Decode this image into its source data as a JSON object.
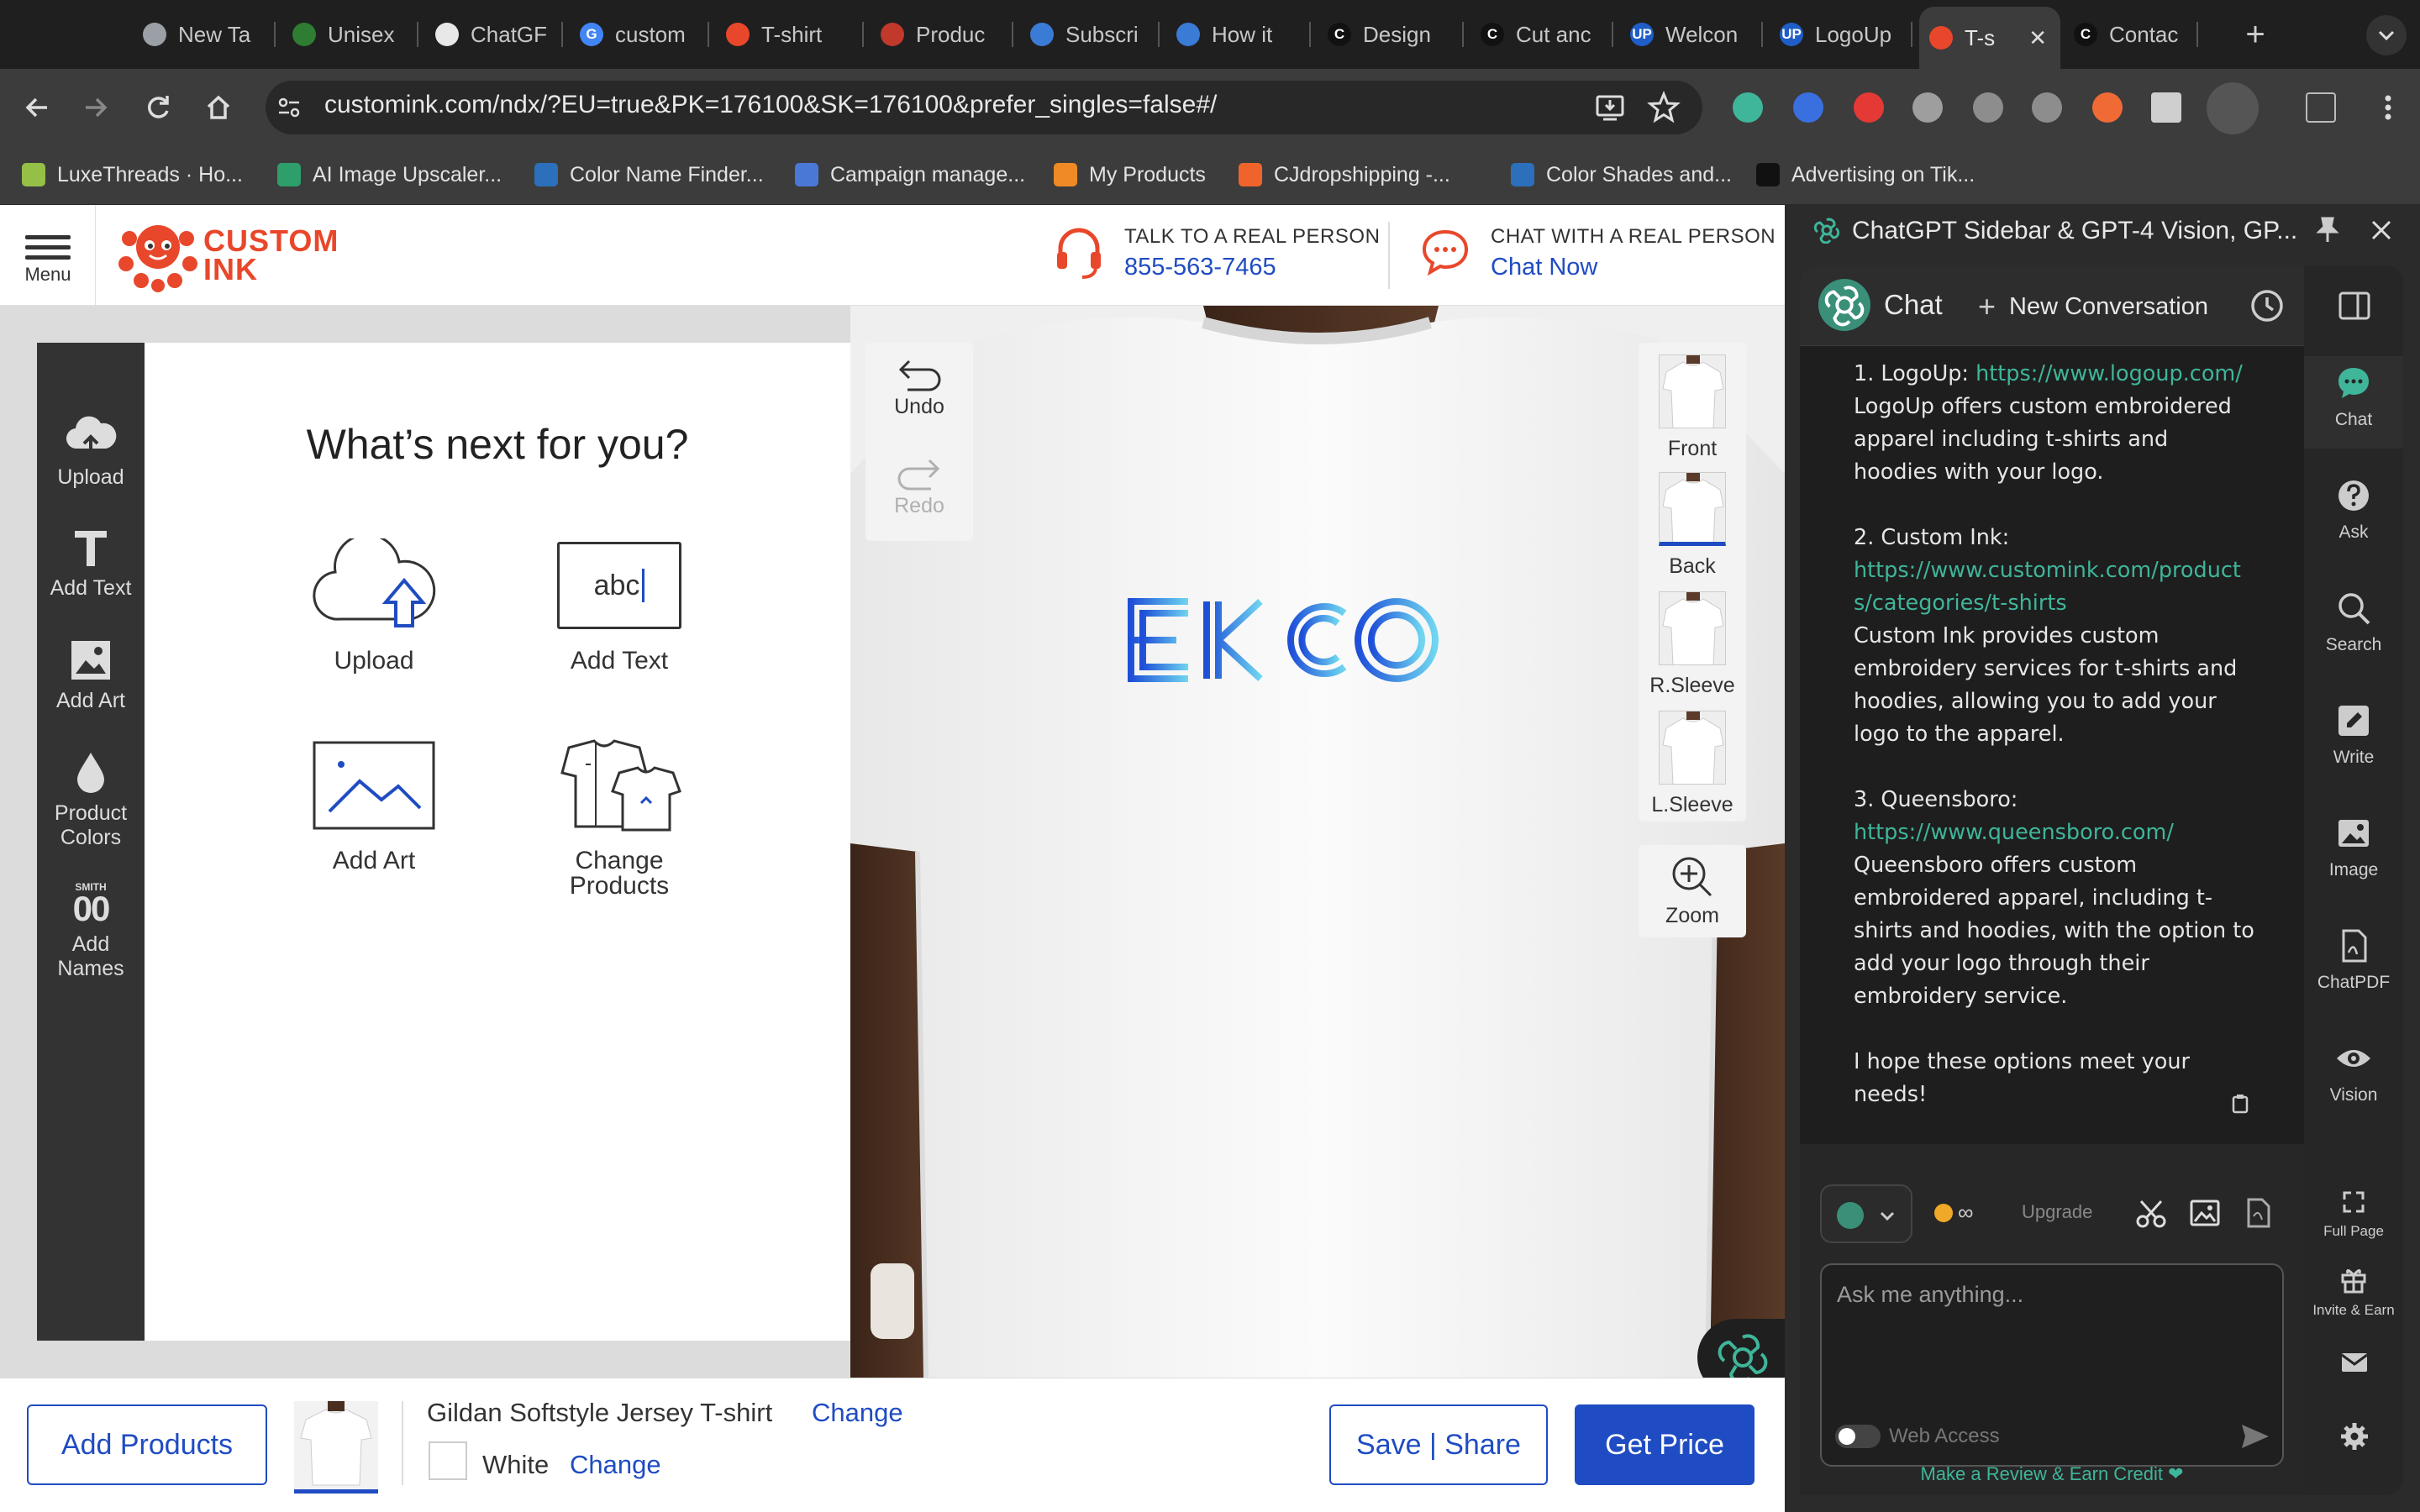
{
  "browser": {
    "tabs": [
      {
        "label": "New Ta",
        "favicon_color": "#9aa0a6",
        "favicon_letter": ""
      },
      {
        "label": "Unisex",
        "favicon_color": "#2e7d32",
        "favicon_letter": ""
      },
      {
        "label": "ChatGF",
        "favicon_color": "#e8e8e8",
        "favicon_letter": ""
      },
      {
        "label": "custom",
        "favicon_color": "#4285f4",
        "favicon_letter": "G"
      },
      {
        "label": "T-shirt",
        "favicon_color": "#e8472b",
        "favicon_letter": ""
      },
      {
        "label": "Produc",
        "favicon_color": "#c0392b",
        "favicon_letter": ""
      },
      {
        "label": "Subscri",
        "favicon_color": "#3a7bd5",
        "favicon_letter": ""
      },
      {
        "label": "How it",
        "favicon_color": "#3a7bd5",
        "favicon_letter": ""
      },
      {
        "label": "Design",
        "favicon_color": "#111111",
        "favicon_letter": "C"
      },
      {
        "label": "Cut anc",
        "favicon_color": "#111111",
        "favicon_letter": "C"
      },
      {
        "label": "Welcon",
        "favicon_color": "#1f5ec7",
        "favicon_letter": "UP"
      },
      {
        "label": "LogoUp",
        "favicon_color": "#1f5ec7",
        "favicon_letter": "UP"
      },
      {
        "label": "T-s",
        "favicon_color": "#e8472b",
        "favicon_letter": "",
        "active": true
      },
      {
        "label": "Contac",
        "favicon_color": "#111111",
        "favicon_letter": "C"
      }
    ],
    "new_tab_symbol": "+",
    "close_tab_symbol": "✕",
    "url": "customink.com/ndx/?EU=true&PK=176100&SK=176100&prefer_singles=false#/",
    "bookmarks": [
      {
        "label": "LuxeThreads · Ho...",
        "color": "#95bf47"
      },
      {
        "label": "AI Image Upscaler...",
        "color": "#2e9e6b"
      },
      {
        "label": "Color Name Finder...",
        "color": "#2c6fbb"
      },
      {
        "label": "Campaign manage...",
        "color": "#4a78d6"
      },
      {
        "label": "My Products",
        "color": "#f08a24"
      },
      {
        "label": "CJdropshipping -...",
        "color": "#f0642b"
      },
      {
        "label": "Color Shades and...",
        "color": "#2c6fbb"
      },
      {
        "label": "Advertising on Tik...",
        "color": "#111111"
      }
    ]
  },
  "site": {
    "menu_label": "Menu",
    "logo_line1": "CUSTOM",
    "logo_line2": "INK",
    "phone_caption": "TALK TO A REAL PERSON",
    "phone_number": "855-563-7465",
    "chat_caption": "CHAT WITH A REAL PERSON",
    "chat_link": "Chat Now",
    "brand_color": "#e8472b",
    "link_color": "#1f4cc2"
  },
  "tools": [
    {
      "label": "Upload",
      "icon": "cloud-upload-icon"
    },
    {
      "label": "Add Text",
      "icon": "text-t-icon"
    },
    {
      "label": "Add Art",
      "icon": "image-icon"
    },
    {
      "label_line1": "Product",
      "label_line2": "Colors",
      "icon": "droplet-icon"
    },
    {
      "label_line1": "Add",
      "label_line2": "Names",
      "icon": "names-icon",
      "icon_text_top": "SMITH",
      "icon_text_main": "00"
    }
  ],
  "panel": {
    "title": "What’s next for you?",
    "options": [
      {
        "label": "Upload",
        "icon": "cloud-upload-icon"
      },
      {
        "label": "Add Text",
        "icon": "text-box-icon",
        "icon_text": "abc"
      },
      {
        "label": "Add Art",
        "icon": "image-icon"
      },
      {
        "label_line1": "Change",
        "label_line2": "Products",
        "icon": "shirts-icon"
      }
    ]
  },
  "history": {
    "undo": "Undo",
    "redo": "Redo"
  },
  "views": [
    {
      "label": "Front"
    },
    {
      "label": "Back",
      "selected": true
    },
    {
      "label": "R.Sleeve"
    },
    {
      "label": "L.Sleeve"
    }
  ],
  "zoom_label": "Zoom",
  "design": {
    "text": "EKCO",
    "gradient_start": "#1e4fd8",
    "gradient_end": "#6fd6f0"
  },
  "bottom": {
    "add_products": "Add Products",
    "product_name": "Gildan Softstyle Jersey T-shirt",
    "change_product": "Change",
    "color_name": "White",
    "change_color": "Change",
    "save_share": "Save | Share",
    "get_price": "Get Price"
  },
  "sidebar": {
    "title": "ChatGPT Sidebar & GPT-4 Vision, GP...",
    "chat_label": "Chat",
    "new_conversation": "New Conversation",
    "message": [
      {
        "lead": "1. LogoUp: ",
        "link": "https://www.logoup.com/",
        "body": "LogoUp offers custom embroidered apparel including t-shirts and hoodies with your logo."
      },
      {
        "lead": "2. Custom Ink:",
        "link": "https://www.customink.com/products/categories/t-shirts",
        "body": "Custom Ink provides custom embroidery services for t-shirts and hoodies, allowing you to add your logo to the apparel."
      },
      {
        "lead": "3. Queensboro:",
        "link": "https://www.queensboro.com/",
        "body": "Queensboro offers custom embroidered apparel, including t-shirts and hoodies, with the option to add your logo through their embroidery service."
      }
    ],
    "closing": "I hope these options meet your needs!",
    "credits": "∞",
    "upgrade": "Upgrade",
    "input_placeholder": "Ask me anything...",
    "web_access": "Web Access",
    "review": "Make a Review & Earn Credit ❤",
    "accent": "#3fb59a",
    "rail": [
      {
        "label": "Chat",
        "icon": "chat-bubble-icon",
        "active": true
      },
      {
        "label": "Ask",
        "icon": "question-icon"
      },
      {
        "label": "Search",
        "icon": "search-icon"
      },
      {
        "label": "Write",
        "icon": "pencil-icon"
      },
      {
        "label": "Image",
        "icon": "image-icon"
      },
      {
        "label": "ChatPDF",
        "icon": "pdf-icon"
      },
      {
        "label": "Vision",
        "icon": "eye-icon"
      }
    ],
    "rail_bottom": [
      {
        "label": "Full Page",
        "icon": "expand-icon"
      },
      {
        "label": "Invite & Earn",
        "icon": "gift-icon"
      }
    ]
  }
}
